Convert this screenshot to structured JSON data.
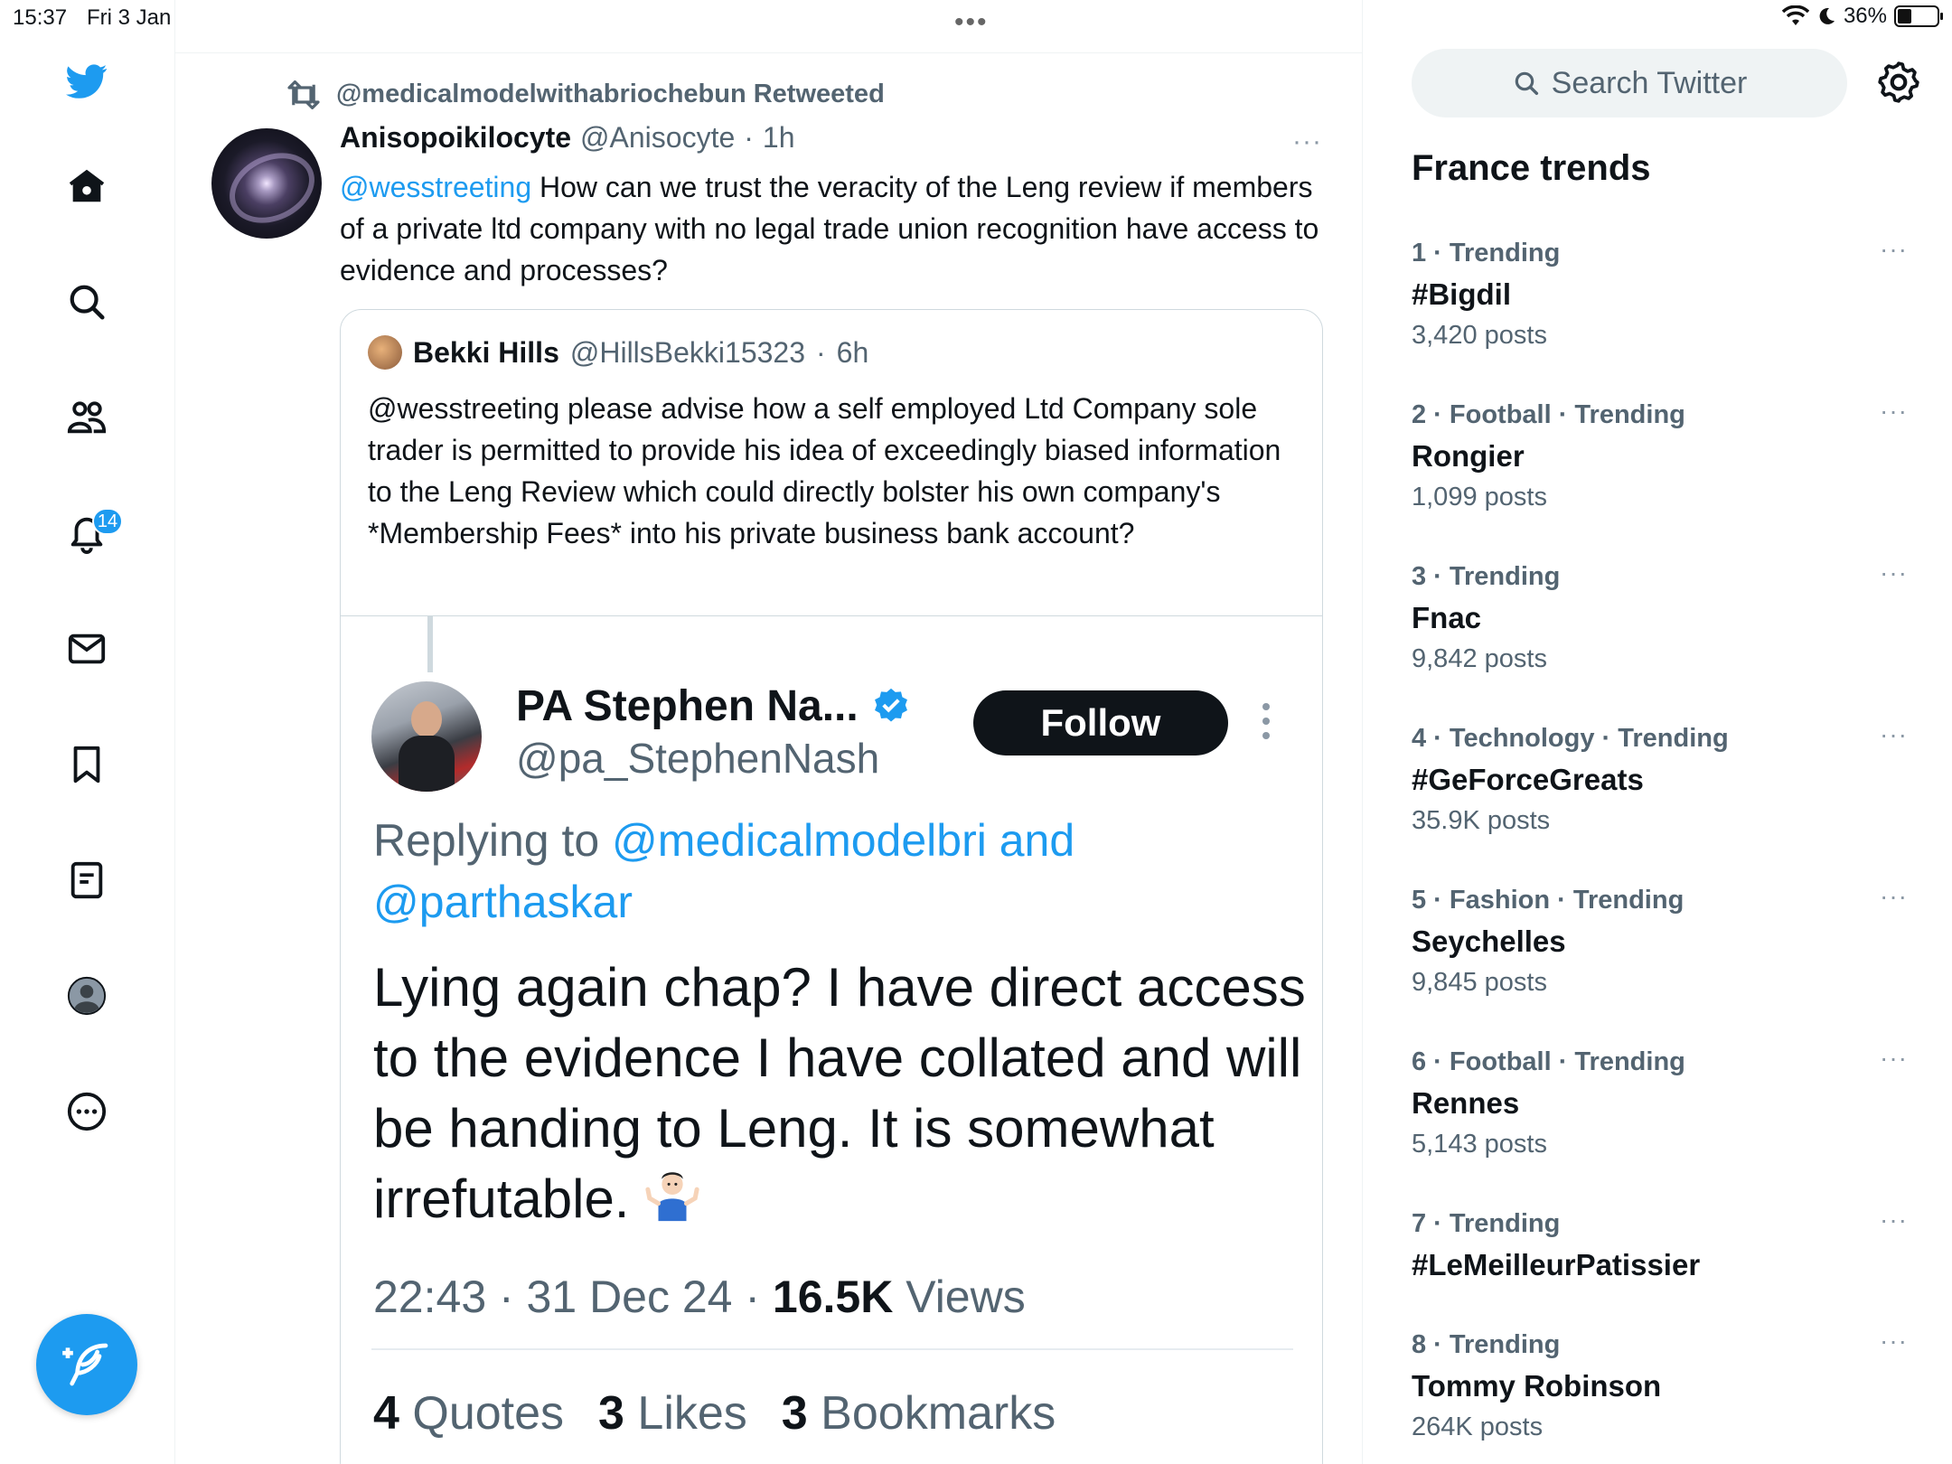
{
  "status_bar": {
    "time": "15:37",
    "date": "Fri 3 Jan",
    "battery": "36%",
    "battery_level": 0.36
  },
  "nav": {
    "notifications_badge": "14"
  },
  "top_dots": "•••",
  "tweet": {
    "retweeted_by": "@medicalmodelwithabriochebun Retweeted",
    "author_name": "Anisopoikilocyte",
    "author_handle": "@Anisocyte",
    "sep": "·",
    "time": "1h",
    "mention": "@wesstreeting",
    "text": " How can we trust the veracity of the Leng review if members of a private ltd company with no legal trade union recognition have access to evidence and processes?",
    "more": "···"
  },
  "quote": {
    "author_name": "Bekki Hills",
    "author_handle": "@HillsBekki15323",
    "sep": "·",
    "time": "6h",
    "text": "@wesstreeting please advise how a self employed Ltd Company sole trader is permitted to provide his idea of exceedingly biased information to the Leng Review which could directly bolster his own company's *Membership Fees* into his private business bank account?"
  },
  "embedded": {
    "name": "PA Stephen Na...",
    "handle": "@pa_StephenNash",
    "follow_label": "Follow",
    "replying_prefix": "Replying to ",
    "replying_mentions_1": "@medicalmodelbri and",
    "replying_mentions_2": "@parthaskar",
    "text": "Lying again chap? I have direct access to the evidence I have collated and will be handing to Leng. It is somewhat irrefutable.",
    "emoji": "person-shrugging",
    "meta_time": "22:43 · 31 Dec 24 · ",
    "views_count": "16.5K",
    "views_label": " Views",
    "quotes_count": "4",
    "quotes_label": " Quotes",
    "likes_count": "3",
    "likes_label": " Likes",
    "bookmarks_count": "3",
    "bookmarks_label": " Bookmarks"
  },
  "sidebar": {
    "search_placeholder": "Search Twitter",
    "trends_title": "France trends",
    "trends": [
      {
        "meta": "1 · Trending",
        "name": "#Bigdil",
        "posts": "3,420 posts"
      },
      {
        "meta": "2 · Football · Trending",
        "name": "Rongier",
        "posts": "1,099 posts"
      },
      {
        "meta": "3 · Trending",
        "name": "Fnac",
        "posts": "9,842 posts"
      },
      {
        "meta": "4 · Technology · Trending",
        "name": "#GeForceGreats",
        "posts": "35.9K posts"
      },
      {
        "meta": "5 · Fashion · Trending",
        "name": "Seychelles",
        "posts": "9,845 posts"
      },
      {
        "meta": "6 · Football · Trending",
        "name": "Rennes",
        "posts": "5,143 posts"
      },
      {
        "meta": "7 · Trending",
        "name": "#LeMeilleurPatissier",
        "posts": ""
      },
      {
        "meta": "8 · Trending",
        "name": "Tommy Robinson",
        "posts": "264K posts"
      }
    ],
    "trend_more": "···"
  },
  "colors": {
    "accent": "#1d9bf0",
    "text": "#0f1419",
    "muted": "#536471"
  }
}
